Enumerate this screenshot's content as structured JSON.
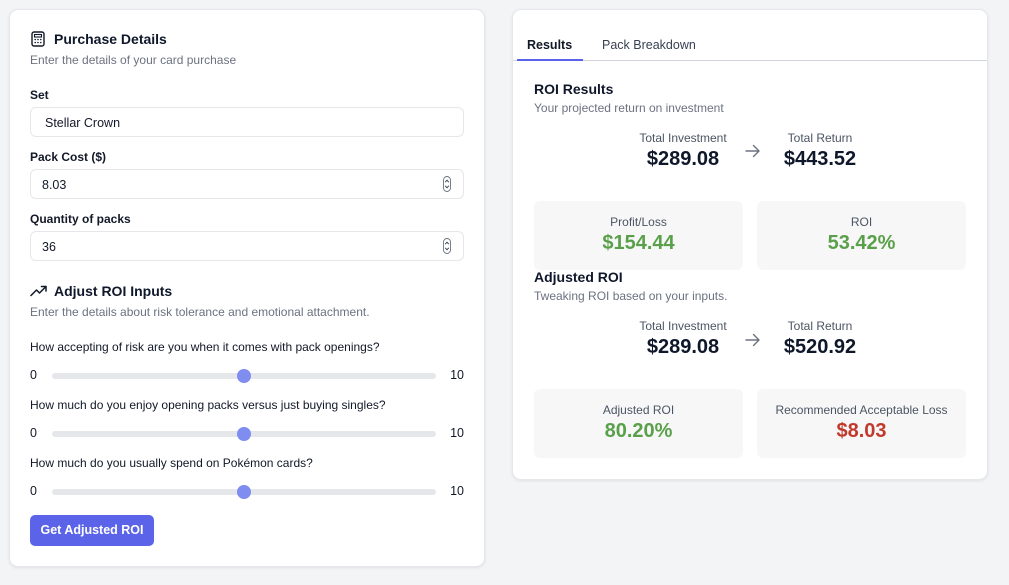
{
  "purchase": {
    "title": "Purchase Details",
    "subtitle": "Enter the details of your card purchase",
    "set_label": "Set",
    "set_value": "Stellar Crown",
    "cost_label": "Pack Cost ($)",
    "cost_value": "8.03",
    "qty_label": "Quantity of packs",
    "qty_value": "36"
  },
  "adjust": {
    "title": "Adjust ROI Inputs",
    "subtitle": "Enter the details about risk tolerance and emotional attachment.",
    "sliders": [
      {
        "question": "How accepting of risk are you when it comes with pack openings?",
        "min": "0",
        "max": "10",
        "value": 5
      },
      {
        "question": "How much do you enjoy opening packs versus just buying singles?",
        "min": "0",
        "max": "10",
        "value": 5
      },
      {
        "question": "How much do you usually spend on Pokémon cards?",
        "min": "0",
        "max": "10",
        "value": 5
      }
    ],
    "button_label": "Get Adjusted ROI"
  },
  "tabs": [
    "Results",
    "Pack Breakdown"
  ],
  "roi": {
    "title": "ROI Results",
    "subtitle": "Your projected return on investment",
    "investment_label": "Total Investment",
    "investment_value": "$289.08",
    "return_label": "Total Return",
    "return_value": "$443.52",
    "profit_label": "Profit/Loss",
    "profit_value": "$154.44",
    "roi_label": "ROI",
    "roi_value": "53.42%"
  },
  "adjusted": {
    "title": "Adjusted ROI",
    "subtitle": "Tweaking ROI based on your inputs.",
    "investment_label": "Total Investment",
    "investment_value": "$289.08",
    "return_label": "Total Return",
    "return_value": "$520.92",
    "adjusted_roi_label": "Adjusted ROI",
    "adjusted_roi_value": "80.20%",
    "loss_label": "Recommended Acceptable Loss",
    "loss_value": "$8.03"
  },
  "colors": {
    "accent": "#5b63e8",
    "slider_thumb": "#7f8cf0",
    "positive": "#5aa04a",
    "negative": "#c0392b"
  },
  "icons": [
    "calculator-icon",
    "trending-up-icon",
    "arrow-right-icon",
    "spinner-icon"
  ]
}
